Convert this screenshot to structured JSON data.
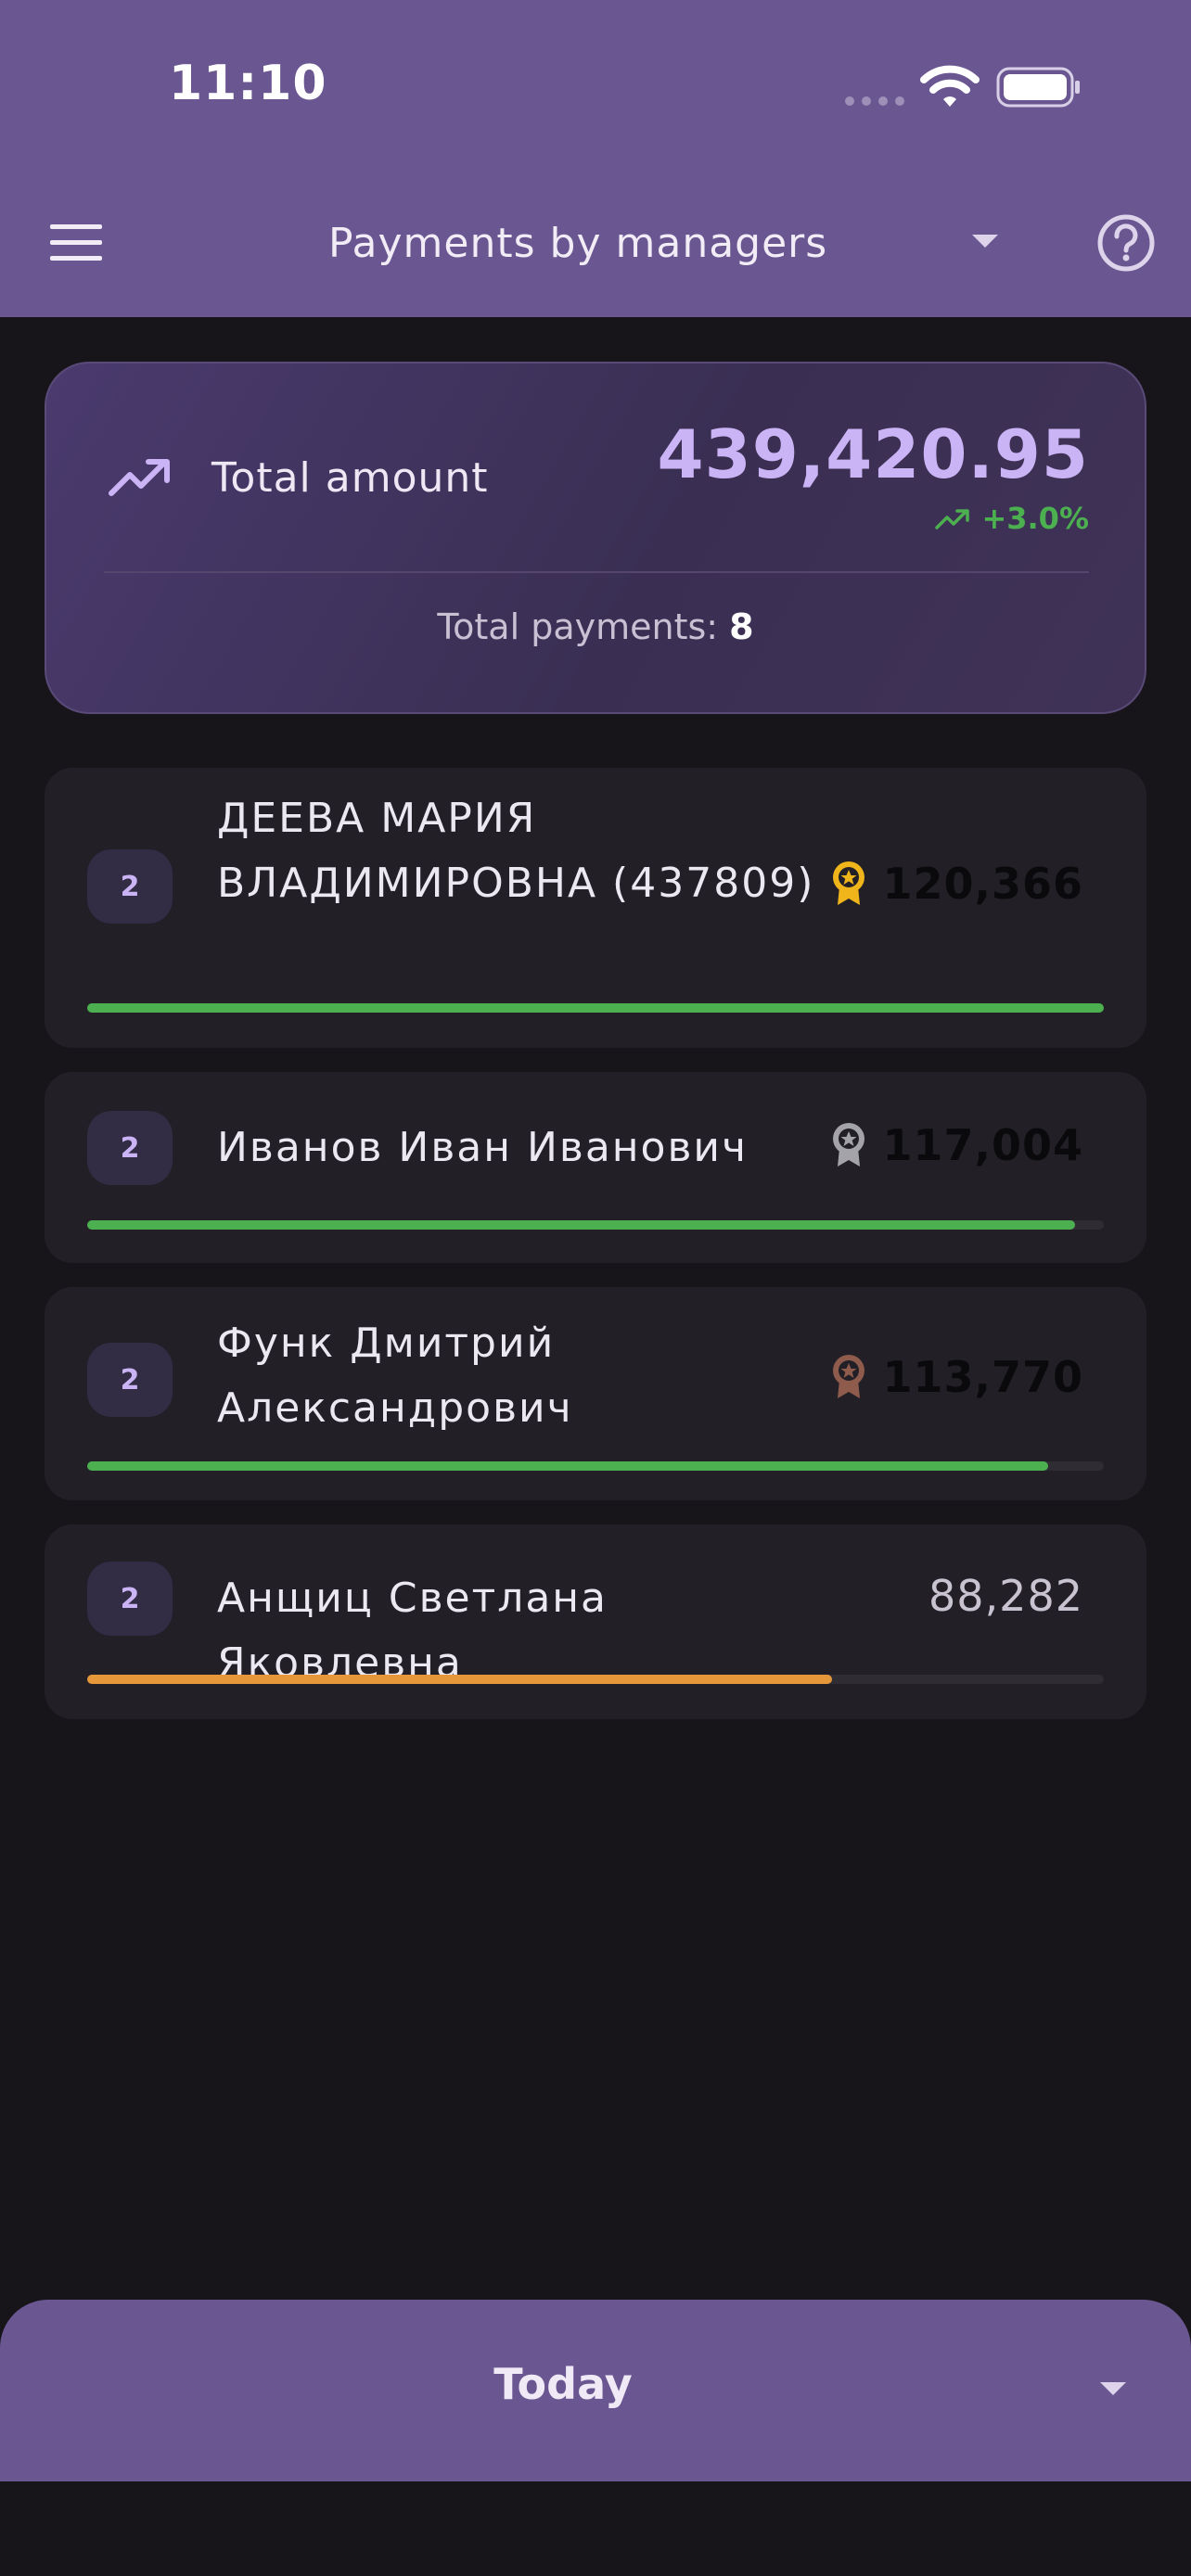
{
  "status_bar": {
    "time": "11:10"
  },
  "app_bar": {
    "title": "Payments by managers"
  },
  "summary": {
    "label": "Total amount",
    "value": "439,420.95",
    "change": "+3.0%",
    "count_label": "Total payments:",
    "count_value": "8"
  },
  "managers": [
    {
      "rank": "2",
      "name": "ДЕЕВА МАРИЯ ВЛАДИМИРОВНА (437809)",
      "amount": "120,366",
      "medal": "gold-medal-icon",
      "progress": 1.0,
      "bar_color": "#4caf50"
    },
    {
      "rank": "2",
      "name": "Иванов Иван Иванович",
      "amount": "117,004",
      "medal": "silver-medal-icon",
      "progress": 0.972,
      "bar_color": "#4caf50"
    },
    {
      "rank": "2",
      "name": "Функ Дмитрий Александрович",
      "amount": "113,770",
      "medal": "bronze-medal-icon",
      "progress": 0.945,
      "bar_color": "#4caf50"
    },
    {
      "rank": "2",
      "name": "Анщиц Светлана Яковлевна",
      "amount": "88,282",
      "medal": "",
      "progress": 0.733,
      "bar_color": "#e5973a"
    }
  ],
  "period": {
    "label": "Today"
  },
  "colors": {
    "accent": "#6a5690",
    "gold": "#f0b51a",
    "silver": "#a5a3aa",
    "bronze": "#8e5b4c"
  }
}
